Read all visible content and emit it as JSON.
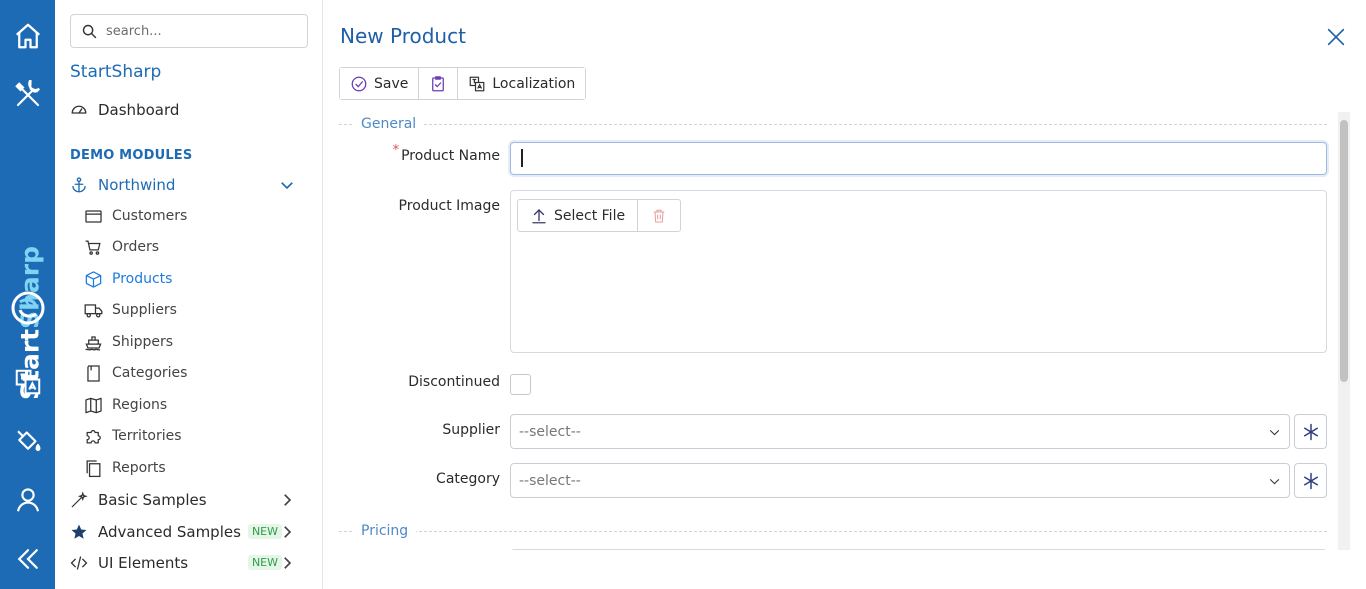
{
  "rail": {
    "brand_start": "Start",
    "brand_sharp": "Sharp",
    "icons": [
      "home-icon",
      "tools-icon",
      "localization-icon",
      "paint-bucket-icon",
      "user-icon",
      "collapse-icon"
    ]
  },
  "sidebar": {
    "search_placeholder": "search...",
    "title": "StartSharp",
    "dashboard": "Dashboard",
    "section_header": "DEMO MODULES",
    "northwind": "Northwind",
    "northwind_items": [
      {
        "label": "Customers",
        "icon": "card-icon"
      },
      {
        "label": "Orders",
        "icon": "cart-icon"
      },
      {
        "label": "Products",
        "icon": "box-icon"
      },
      {
        "label": "Suppliers",
        "icon": "truck-icon"
      },
      {
        "label": "Shippers",
        "icon": "ship-icon"
      },
      {
        "label": "Categories",
        "icon": "folder-icon"
      },
      {
        "label": "Regions",
        "icon": "map-icon"
      },
      {
        "label": "Territories",
        "icon": "puzzle-icon"
      },
      {
        "label": "Reports",
        "icon": "files-icon"
      }
    ],
    "basic_samples": "Basic Samples",
    "advanced_samples": "Advanced Samples",
    "ui_elements": "UI Elements",
    "new_badge": "NEW"
  },
  "dialog": {
    "title": "New Product",
    "toolbar": {
      "save": "Save",
      "localization": "Localization"
    },
    "categories": {
      "general": "General",
      "pricing": "Pricing"
    },
    "fields": {
      "product_name_label": "Product Name",
      "product_name_required": "*",
      "product_name_value": "",
      "product_image_label": "Product Image",
      "select_file": "Select File",
      "discontinued_label": "Discontinued",
      "discontinued_checked": false,
      "supplier_label": "Supplier",
      "supplier_value": "--select--",
      "category_label": "Category",
      "category_value": "--select--"
    }
  },
  "colors": {
    "rail": "#1e6bb5",
    "accent": "#1e6bb5",
    "active_link": "#1e7be0",
    "category_title": "#4f89c6",
    "required": "#d9534f",
    "new_badge": "#2e9e47"
  }
}
